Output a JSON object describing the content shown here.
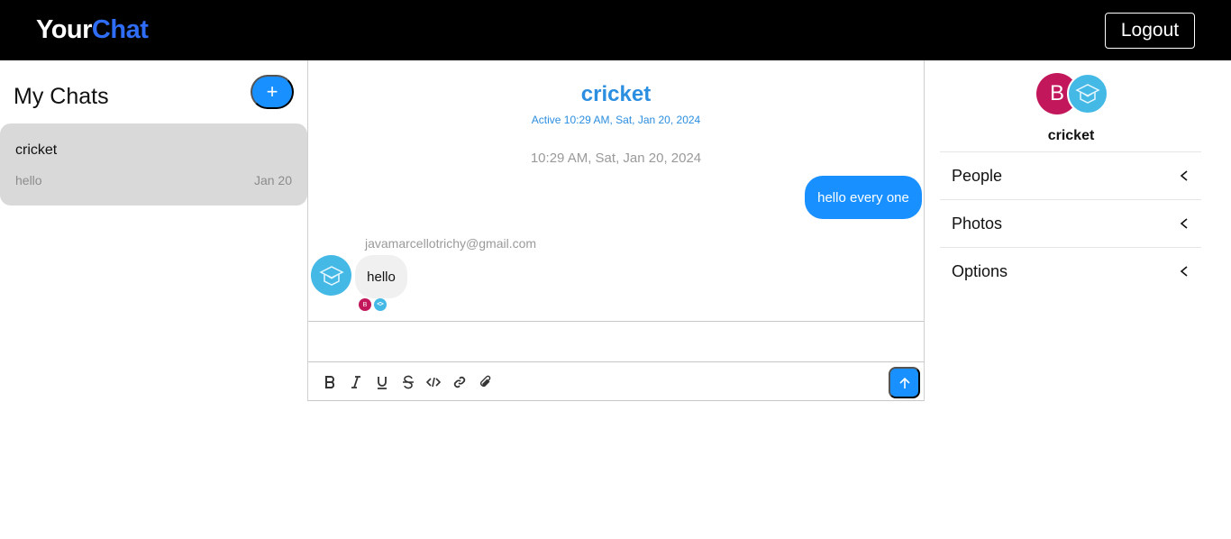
{
  "header": {
    "brand_part1": "Your",
    "brand_part2": "Chat",
    "logout_label": "Logout"
  },
  "colors": {
    "brand_accent": "#2f6df6",
    "primary": "#1890ff",
    "title_blue": "#2b8ee0",
    "avatar_b": "#c2185b",
    "avatar_chat": "#44b9e6"
  },
  "sidebar": {
    "title": "My Chats",
    "new_chat_label": "+",
    "chats": [
      {
        "name": "cricket",
        "preview": "hello",
        "date": "Jan 20"
      }
    ]
  },
  "chat": {
    "title": "cricket",
    "active_text": "Active 10:29 AM, Sat, Jan 20, 2024",
    "timestamp": "10:29 AM, Sat, Jan 20, 2024",
    "messages": [
      {
        "mine": true,
        "text": "hello every one"
      },
      {
        "mine": false,
        "sender": "javamarcellotrichy@gmail.com",
        "text": "hello"
      }
    ],
    "read_receipts": [
      {
        "initial": "B"
      },
      {
        "icon": "school-logo-icon"
      }
    ],
    "composer_value": "",
    "toolbar_icons": [
      "bold-icon",
      "italic-icon",
      "underline-icon",
      "strikethrough-icon",
      "code-icon",
      "link-icon",
      "attachment-icon"
    ],
    "send_icon": "arrow-up-icon"
  },
  "details": {
    "avatar_initial": "B",
    "chat_name": "cricket",
    "sections": [
      {
        "label": "People"
      },
      {
        "label": "Photos"
      },
      {
        "label": "Options"
      }
    ]
  }
}
